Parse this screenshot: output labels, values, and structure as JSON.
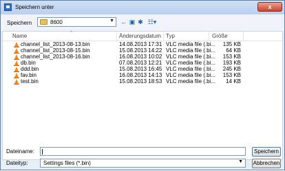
{
  "window": {
    "title": "Speichern unter",
    "close_symbol": "x"
  },
  "toolbar": {
    "save_in_label": "Speichern",
    "location": "8600"
  },
  "list": {
    "columns": {
      "name": "Name",
      "date": "Änderungsdatum",
      "type": "Typ",
      "size": "Größe"
    },
    "files": [
      {
        "name": "channel_list_2013-08-13.bin",
        "date": "14.08.2013 17:31",
        "type": "VLC media file (.bi...",
        "size": "135 KB"
      },
      {
        "name": "channel_list_2013-08-15.bin",
        "date": "15.08.2013 14:22",
        "type": "VLC media file (.bi...",
        "size": "64 KB"
      },
      {
        "name": "channel_list_2013-08-16.bin",
        "date": "16.08.2013 10:02",
        "type": "VLC media file (.bi...",
        "size": "153 KB"
      },
      {
        "name": "db.bin",
        "date": "07.08.2013 12:21",
        "type": "VLC media file (.bi...",
        "size": "193 KB"
      },
      {
        "name": "ddd.bin",
        "date": "15.08.2013 16:45",
        "type": "VLC media file (.bi...",
        "size": "245 KB"
      },
      {
        "name": "fav.bin",
        "date": "16.08.2013 14:13",
        "type": "VLC media file (.bi...",
        "size": "153 KB"
      },
      {
        "name": "test.bin",
        "date": "15.08.2013 18:53",
        "type": "VLC media file (.bi...",
        "size": "14 KB"
      }
    ]
  },
  "footer": {
    "filename_label": "Dateiname:",
    "filename_value": "",
    "filetype_label": "Dateityp:",
    "filetype_value": "Settings files (*.bin)",
    "save_button": "Speichern",
    "cancel_button": "Abbrechen"
  },
  "colors": {
    "titlebar": "#b9d0ee",
    "vlc_cone": "#f08a1c",
    "accent_border": "#7a96bd"
  }
}
